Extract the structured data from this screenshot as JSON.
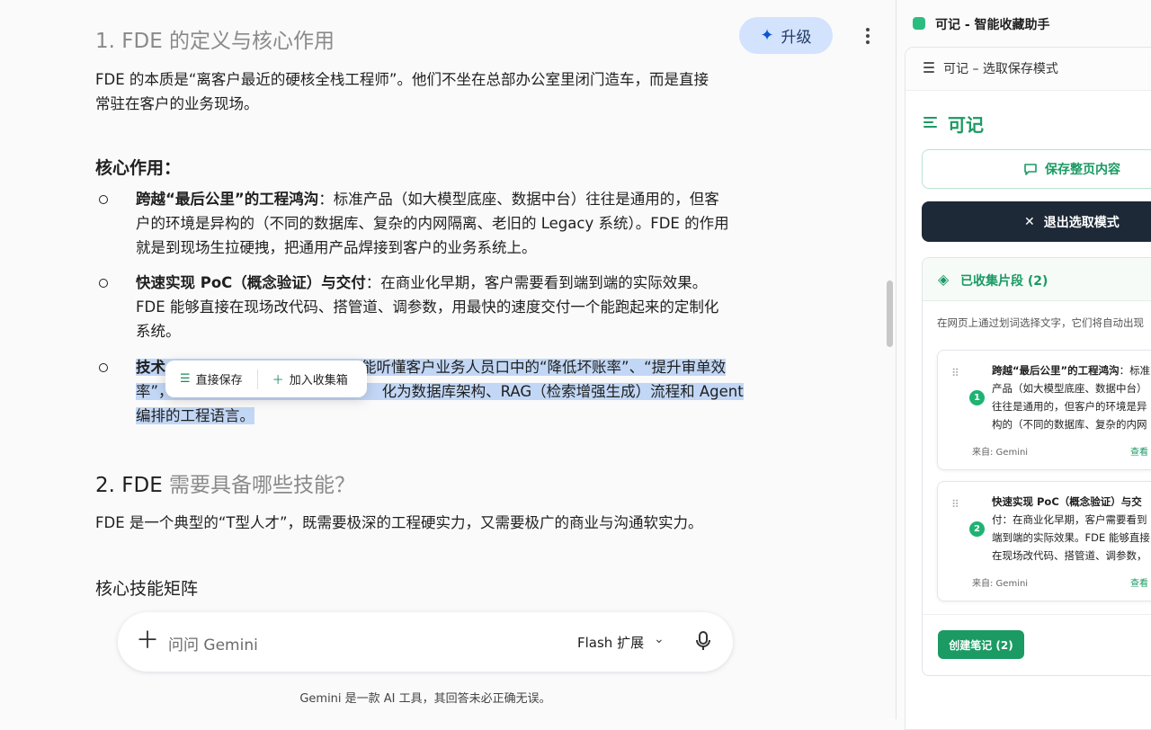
{
  "main": {
    "heading1_num": "1. FDE",
    "heading1_rest": " 的定义与核心作用",
    "upgrade_label": "升级",
    "intro_line1": "FDE 的本质是“离客户最近的硬核全栈工程师”。他们不坐在总部办公室里闭门造车，而是直接",
    "intro_line2": "常驻在客户的业务现场。",
    "core_heading": "核心作用：",
    "items": [
      {
        "title": "跨越“最后公里”的工程鸿沟",
        "lines": [
          "：标准产品（如大模型底座、数据中台）往往是通用的，但客",
          "户的环境是异构的（不同的数据库、复杂的内网隔离、老旧的 Legacy 系统）。FDE 的作用",
          "就是到现场生拉硬拽，把通用产品焊接到客户的业务系统上。"
        ]
      },
      {
        "title": "快速实现 PoC（概念验证）与交付",
        "lines": [
          "：在商业化早期，客户需要看到端到端的实际效果。",
          "FDE 能够直接在现场改代码、搭管道、调参数，用最快的速度交付一个能跑起来的定制化",
          "系统。"
        ]
      },
      {
        "title": "技术",
        "lines": [
          "能听懂客户业务人员口中的“降低坏账率”、“提升审单效",
          "率”，",
          "化为数据库架构、RAG（检索增强生成）流程和 Agent",
          "编排的工程语言。"
        ]
      }
    ],
    "heading2_num": "2. FDE",
    "heading2_rest": " 需要具备哪些技能？",
    "tperson": "FDE 是一个典型的“T型人才”，既需要极深的工程硬实力，又需要极广的商业与沟通软实力。",
    "matrix_heading": "核心技能矩阵",
    "popup": {
      "save": "直接保存",
      "add": "加入收集箱"
    },
    "chat": {
      "placeholder": "问问 Gemini",
      "model": "Flash 扩展"
    },
    "disclaimer": "Gemini 是一款 AI 工具，其回答未必正确无误。"
  },
  "panel": {
    "window_title": "可记 - 智能收藏助手",
    "top_title": "可记 – 选取保存模式",
    "brand": "可记",
    "save_page": "保存整页内容",
    "exit_mode": "退出选取模式",
    "collected_label": "已收集片段 (2)",
    "hint": "在网页上通过划词选择文字，它们将自动出现",
    "cards": [
      {
        "index": "1",
        "title": "跨越“最后公里”的工程鸿沟",
        "line1_rest": "：标准",
        "lines": [
          "产品（如大模型底座、数据中台）",
          "往往是通用的，但客户的环境是异",
          "构的（不同的数据库、复杂的内网"
        ],
        "source": "来自: Gemini",
        "view": "查看"
      },
      {
        "index": "2",
        "title": "快速实现 PoC（概念验证）与交",
        "line1_rest": "",
        "lines": [
          "付：在商业化早期，客户需要看到",
          "端到端的实际效果。FDE 能够直接",
          "在现场改代码、搭管道、调参数，"
        ],
        "source": "来自: Gemini",
        "view": "查看"
      }
    ],
    "create_note": "创建笔记 (2)"
  },
  "colors": {
    "accent_green": "#1b9a63",
    "selection": "#c2d7f5",
    "dark_button": "#1e2938",
    "upgrade_bg": "#d3e3fd"
  }
}
